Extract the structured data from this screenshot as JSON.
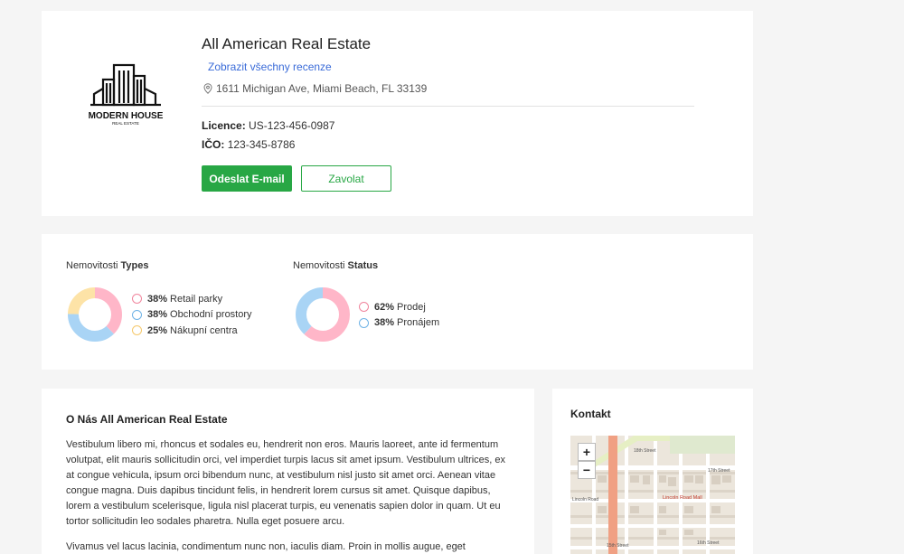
{
  "agency": {
    "name": "All American Real Estate",
    "reviews_link": "Zobrazit všechny recenze",
    "address": "1611 Michigan Ave, Miami Beach, FL 33139",
    "licence_label": "Licence:",
    "licence_value": "US-123-456-0987",
    "ico_label": "IČO:",
    "ico_value": "123-345-8786",
    "email_button": "Odeslat E-mail",
    "call_button": "Zavolat",
    "logo": {
      "icon": "building-icon",
      "name": "MODERN HOUSE",
      "tagline": "REAL ESTATE"
    }
  },
  "stats": {
    "types": {
      "title_prefix": "Nemovitosti",
      "title_bold": "Types",
      "items": [
        {
          "percent": 38,
          "label": "Retail parky",
          "color": "#ffb6c8"
        },
        {
          "percent": 38,
          "label": "Obchodní prostory",
          "color": "#a9d4f5"
        },
        {
          "percent": 25,
          "label": "Nákupní centra",
          "color": "#fde3a7"
        }
      ]
    },
    "status": {
      "title_prefix": "Nemovitosti",
      "title_bold": "Status",
      "items": [
        {
          "percent": 62,
          "label": "Prodej",
          "color": "#ffb6c8"
        },
        {
          "percent": 38,
          "label": "Pronájem",
          "color": "#a9d4f5"
        }
      ]
    }
  },
  "about": {
    "title": "O Nás All American Real Estate",
    "paragraph1": "Vestibulum libero mi, rhoncus et sodales eu, hendrerit non eros. Mauris laoreet, ante id fermentum volutpat, elit mauris sollicitudin orci, vel imperdiet turpis lacus sit amet ipsum. Vestibulum ultrices, ex at congue vehicula, ipsum orci bibendum nunc, at vestibulum nisl justo sit amet orci. Aenean vitae congue magna. Duis dapibus tincidunt felis, in hendrerit lorem cursus sit amet. Quisque dapibus, lorem a vestibulum scelerisque, ligula nisl placerat turpis, eu venenatis sapien dolor in quam. Ut eu tortor sollicitudin leo sodales pharetra. Nulla eget posuere arcu.",
    "paragraph2": "Vivamus vel lacus lacinia, condimentum nunc non, iaculis diam. Proin in mollis augue, eget fermentum"
  },
  "contact": {
    "title": "Kontakt",
    "map": {
      "zoom_in": "+",
      "zoom_out": "−",
      "labels": [
        "18th Street",
        "17th Street",
        "16th Street",
        "15th Street",
        "Lincoln Road Mall",
        "Lincoln Road",
        "Drexel Avenue",
        "Jefferson Avenue",
        "Meridian Avenue",
        "Washington Avenue",
        "Michigan Avenue"
      ]
    }
  },
  "colors": {
    "accent_green": "#28a745",
    "link_blue": "#3a6bd8",
    "background": "#f5f5f5"
  }
}
